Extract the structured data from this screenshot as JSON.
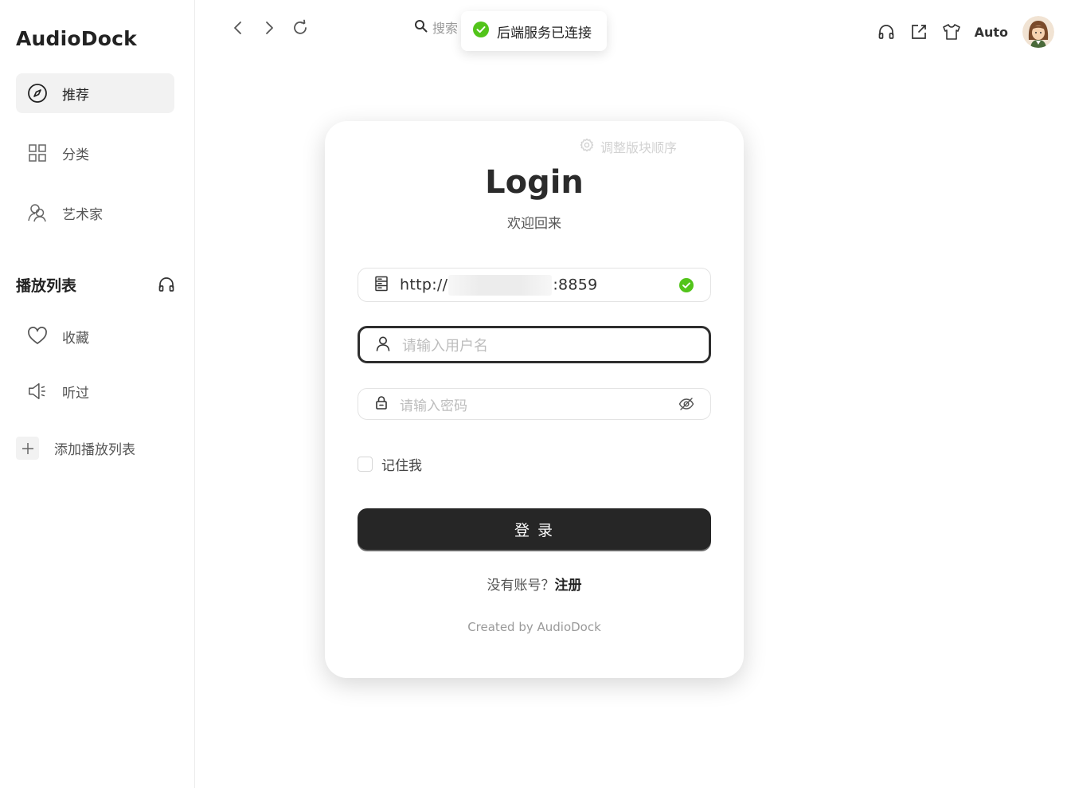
{
  "app": {
    "brand": "AudioDock"
  },
  "sidebar": {
    "items": [
      {
        "label": "推荐",
        "icon": "compass-icon",
        "active": true
      },
      {
        "label": "分类",
        "icon": "grid-icon",
        "active": false
      },
      {
        "label": "艺术家",
        "icon": "artist-icon",
        "active": false
      }
    ],
    "playlist_section": {
      "title": "播放列表",
      "icon": "headphones-icon",
      "items": [
        {
          "label": "收藏",
          "icon": "heart-icon"
        },
        {
          "label": "听过",
          "icon": "speaker-icon"
        }
      ],
      "add_label": "添加播放列表"
    }
  },
  "topbar": {
    "search_placeholder": "搜索",
    "theme_label": "Auto"
  },
  "toast": {
    "message": "后端服务已连接",
    "status_color": "#52c41a"
  },
  "login": {
    "reorder_label": "调整版块顺序",
    "title": "Login",
    "subtitle": "欢迎回来",
    "server_prefix": "http://",
    "server_suffix": ":8859",
    "username_placeholder": "请输入用户名",
    "password_placeholder": "请输入密码",
    "remember_label": "记住我",
    "submit_label": "登 录",
    "register_prompt": "没有账号？",
    "register_link": "注册",
    "footer": "Created by AudioDock"
  }
}
